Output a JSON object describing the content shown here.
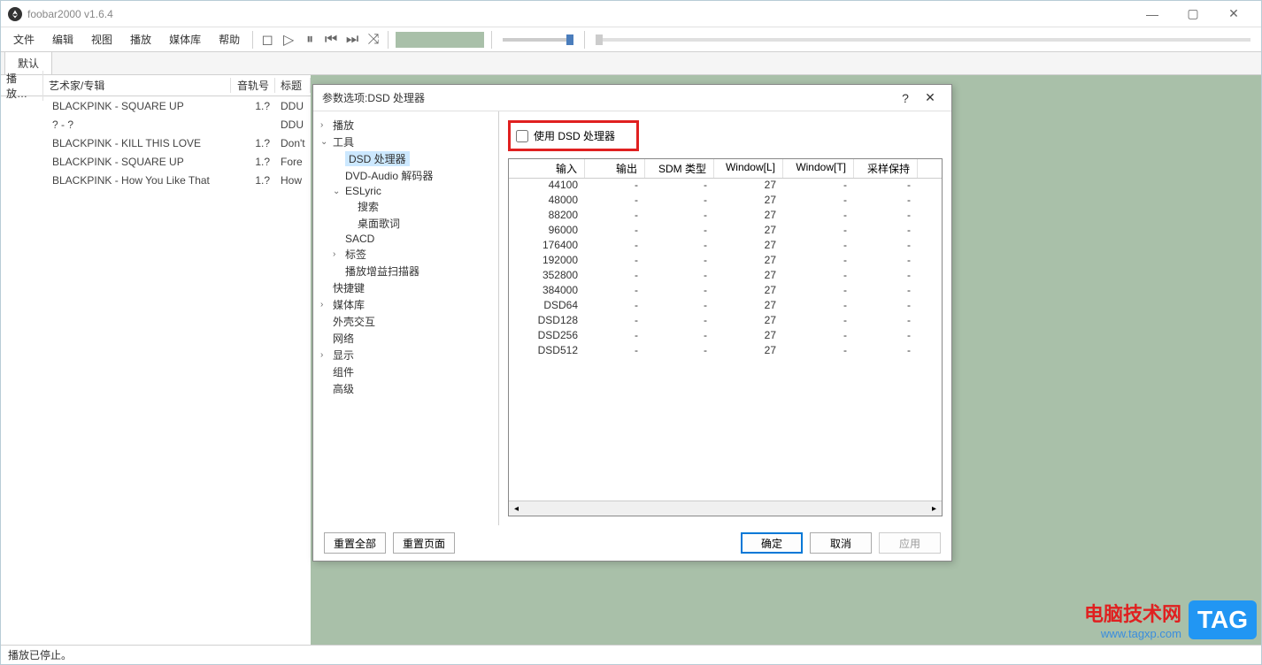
{
  "window": {
    "title": "foobar2000 v1.6.4"
  },
  "menu": {
    "items": [
      "文件",
      "编辑",
      "视图",
      "播放",
      "媒体库",
      "帮助"
    ]
  },
  "tabs": {
    "default": "默认"
  },
  "playlist": {
    "headers": {
      "play": "播放…",
      "artist": "艺术家/专辑",
      "track": "音轨号",
      "title": "标题"
    },
    "rows": [
      {
        "artist": "BLACKPINK - SQUARE UP",
        "track": "1.?",
        "title": "DDU"
      },
      {
        "artist": "? - ?",
        "track": "",
        "title": "DDU"
      },
      {
        "artist": "BLACKPINK - KILL THIS LOVE",
        "track": "1.?",
        "title": "Don't"
      },
      {
        "artist": "BLACKPINK - SQUARE UP",
        "track": "1.?",
        "title": "Fore"
      },
      {
        "artist": "BLACKPINK - How You Like That",
        "track": "1.?",
        "title": "How"
      }
    ]
  },
  "dialog": {
    "title": "参数选项:DSD 处理器",
    "tree": [
      {
        "label": "播放",
        "depth": 0,
        "arrow": "›"
      },
      {
        "label": "工具",
        "depth": 0,
        "arrow": "⌄"
      },
      {
        "label": "DSD 处理器",
        "depth": 1,
        "arrow": "",
        "selected": true
      },
      {
        "label": "DVD-Audio 解码器",
        "depth": 1,
        "arrow": ""
      },
      {
        "label": "ESLyric",
        "depth": 1,
        "arrow": "⌄"
      },
      {
        "label": "搜索",
        "depth": 2,
        "arrow": ""
      },
      {
        "label": "桌面歌词",
        "depth": 2,
        "arrow": ""
      },
      {
        "label": "SACD",
        "depth": 1,
        "arrow": ""
      },
      {
        "label": "标签",
        "depth": 1,
        "arrow": "›"
      },
      {
        "label": "播放增益扫描器",
        "depth": 1,
        "arrow": ""
      },
      {
        "label": "快捷键",
        "depth": 0,
        "arrow": ""
      },
      {
        "label": "媒体库",
        "depth": 0,
        "arrow": "›"
      },
      {
        "label": "外壳交互",
        "depth": 0,
        "arrow": ""
      },
      {
        "label": "网络",
        "depth": 0,
        "arrow": ""
      },
      {
        "label": "显示",
        "depth": 0,
        "arrow": "›"
      },
      {
        "label": "组件",
        "depth": 0,
        "arrow": ""
      },
      {
        "label": "高级",
        "depth": 0,
        "arrow": ""
      }
    ],
    "checkbox_label": "使用 DSD 处理器",
    "table": {
      "headers": {
        "input": "输入",
        "output": "输出",
        "sdm": "SDM 类型",
        "wl": "Window[L]",
        "wt": "Window[T]",
        "res": "采样保持"
      },
      "rows": [
        {
          "input": "44100",
          "output": "-",
          "sdm": "-",
          "wl": "27",
          "wt": "-",
          "res": "-"
        },
        {
          "input": "48000",
          "output": "-",
          "sdm": "-",
          "wl": "27",
          "wt": "-",
          "res": "-"
        },
        {
          "input": "88200",
          "output": "-",
          "sdm": "-",
          "wl": "27",
          "wt": "-",
          "res": "-"
        },
        {
          "input": "96000",
          "output": "-",
          "sdm": "-",
          "wl": "27",
          "wt": "-",
          "res": "-"
        },
        {
          "input": "176400",
          "output": "-",
          "sdm": "-",
          "wl": "27",
          "wt": "-",
          "res": "-"
        },
        {
          "input": "192000",
          "output": "-",
          "sdm": "-",
          "wl": "27",
          "wt": "-",
          "res": "-"
        },
        {
          "input": "352800",
          "output": "-",
          "sdm": "-",
          "wl": "27",
          "wt": "-",
          "res": "-"
        },
        {
          "input": "384000",
          "output": "-",
          "sdm": "-",
          "wl": "27",
          "wt": "-",
          "res": "-"
        },
        {
          "input": "DSD64",
          "output": "-",
          "sdm": "-",
          "wl": "27",
          "wt": "-",
          "res": "-"
        },
        {
          "input": "DSD128",
          "output": "-",
          "sdm": "-",
          "wl": "27",
          "wt": "-",
          "res": "-"
        },
        {
          "input": "DSD256",
          "output": "-",
          "sdm": "-",
          "wl": "27",
          "wt": "-",
          "res": "-"
        },
        {
          "input": "DSD512",
          "output": "-",
          "sdm": "-",
          "wl": "27",
          "wt": "-",
          "res": "-"
        }
      ]
    },
    "buttons": {
      "reset_all": "重置全部",
      "reset_page": "重置页面",
      "ok": "确定",
      "cancel": "取消",
      "apply": "应用"
    }
  },
  "status": {
    "text": "播放已停止。"
  },
  "watermark": {
    "cn": "电脑技术网",
    "url": "www.tagxp.com",
    "tag": "TAG"
  }
}
